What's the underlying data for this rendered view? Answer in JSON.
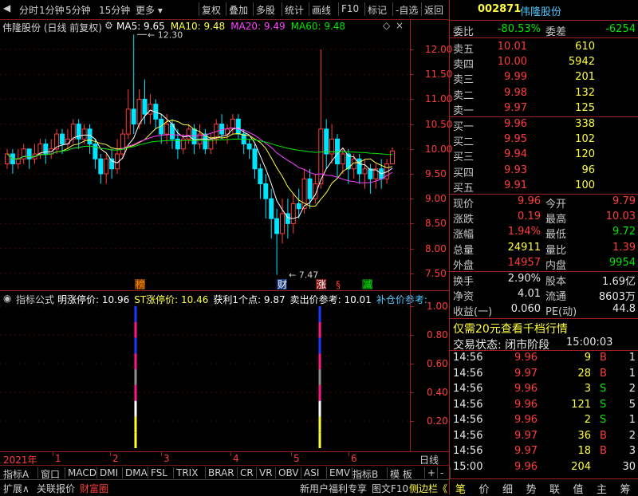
{
  "toolbar": {
    "left_items": [
      "分时",
      "1分钟",
      "5分钟",
      "15分钟",
      "更多"
    ],
    "right_items": [
      "复权",
      "叠加",
      "多股",
      "统计",
      "画线",
      "F10",
      "标记",
      "-自选",
      "返回"
    ]
  },
  "kline": {
    "title": "伟隆股份 (日线 前复权)",
    "ma": [
      {
        "label": "MA5: 9.65",
        "color": "#ffffff"
      },
      {
        "label": "MA10: 9.48",
        "color": "#ffff40"
      },
      {
        "label": "MA20: 9.49",
        "color": "#ff40ff"
      },
      {
        "label": "MA60: 9.48",
        "color": "#00e600"
      }
    ],
    "yticks": [
      "12.00",
      "11.50",
      "11.00",
      "10.50",
      "10.00",
      "9.50",
      "9.00",
      "8.50",
      "8.00",
      "7.50"
    ],
    "high_label": "12.30",
    "low_label": "7.47",
    "markers": [
      {
        "text": "榜",
        "color": "#ff8c00"
      },
      {
        "text": "财",
        "color": "#ffffff"
      },
      {
        "text": "涨",
        "color": "#ffffff"
      },
      {
        "text": "§",
        "color": "#ff3c3c"
      },
      {
        "text": "减",
        "color": "#00e600"
      }
    ]
  },
  "indicator": {
    "name": "指标公式",
    "items": [
      {
        "label": "明涨停价: 10.96",
        "color": "#ffffff"
      },
      {
        "label": "ST涨停价: 10.46",
        "color": "#ffff40"
      },
      {
        "label": "获利1个点: 9.87",
        "color": "#ffffff"
      },
      {
        "label": "卖出价参考: 10.01",
        "color": "#ffffff"
      },
      {
        "label": "补仓价参考:",
        "color": "#4fc8ff"
      }
    ],
    "yticks": [
      "1.00",
      "0.80",
      "0.60",
      "0.40",
      "0.20"
    ]
  },
  "xaxis": {
    "labels": [
      "2021年",
      "1",
      "2",
      "3",
      "4",
      "5",
      "6"
    ],
    "period": "日线"
  },
  "indicator_tabs": [
    "指标A",
    "窗口",
    "MACD",
    "DMI",
    "DMA",
    "FSL",
    "TRIX",
    "BRAR",
    "CR",
    "VR",
    "OBV",
    "ASI",
    "EMV",
    "指标B",
    "模 板",
    "+",
    "-"
  ],
  "statusbar": {
    "items": [
      "扩展∧",
      "关联报价",
      "财富圈"
    ],
    "right_items": [
      "新用户福利专享",
      "图文F10",
      "侧边栏《"
    ]
  },
  "quote": {
    "code": "002871",
    "name": "伟隆股份",
    "weibi_label": "委比",
    "weibi": "-80.53%",
    "weicha_label": "委差",
    "weicha": "-6254",
    "asks": [
      {
        "label": "卖五",
        "price": "10.01",
        "vol": "610"
      },
      {
        "label": "卖四",
        "price": "10.00",
        "vol": "5942"
      },
      {
        "label": "卖三",
        "price": "9.99",
        "vol": "201"
      },
      {
        "label": "卖二",
        "price": "9.98",
        "vol": "132"
      },
      {
        "label": "卖一",
        "price": "9.97",
        "vol": "125"
      }
    ],
    "bids": [
      {
        "label": "买一",
        "price": "9.96",
        "vol": "338"
      },
      {
        "label": "买二",
        "price": "9.95",
        "vol": "102"
      },
      {
        "label": "买三",
        "price": "9.94",
        "vol": "120"
      },
      {
        "label": "买四",
        "price": "9.93",
        "vol": "96"
      },
      {
        "label": "买五",
        "price": "9.91",
        "vol": "100"
      }
    ],
    "stats": [
      {
        "l1": "现价",
        "v1": "9.96",
        "c1": "red",
        "l2": "今开",
        "v2": "9.79",
        "c2": "red"
      },
      {
        "l1": "涨跌",
        "v1": "0.19",
        "c1": "red",
        "l2": "最高",
        "v2": "10.03",
        "c2": "red"
      },
      {
        "l1": "涨幅",
        "v1": "1.94%",
        "c1": "red",
        "l2": "最低",
        "v2": "9.72",
        "c2": "green"
      },
      {
        "l1": "总量",
        "v1": "24911",
        "c1": "yellow",
        "l2": "量比",
        "v2": "1.39",
        "c2": "red"
      },
      {
        "l1": "外盘",
        "v1": "14957",
        "c1": "red",
        "l2": "内盘",
        "v2": "9954",
        "c2": "green"
      }
    ],
    "stats2": [
      {
        "l1": "换手",
        "v1": "2.90%",
        "l2": "股本",
        "v2": "1.69亿"
      },
      {
        "l1": "净资",
        "v1": "4.01",
        "l2": "流通",
        "v2": "8603万"
      },
      {
        "l1": "收益(一)",
        "v1": "0.060",
        "l2": "PE(动)",
        "v2": "44.8"
      }
    ],
    "promo": "仅需20元查看千档行情",
    "trade_status_label": "交易状态: 闭市阶段",
    "trade_status_time": "15:00:03",
    "ticks": [
      {
        "time": "14:56",
        "price": "9.96",
        "vol": "9",
        "side": "B",
        "n": "1"
      },
      {
        "time": "14:56",
        "price": "9.97",
        "vol": "28",
        "side": "B",
        "n": "1"
      },
      {
        "time": "14:56",
        "price": "9.96",
        "vol": "3",
        "side": "S",
        "n": "2"
      },
      {
        "time": "14:56",
        "price": "9.96",
        "vol": "121",
        "side": "S",
        "n": "5"
      },
      {
        "time": "14:56",
        "price": "9.96",
        "vol": "2",
        "side": "S",
        "n": "1"
      },
      {
        "time": "14:56",
        "price": "9.97",
        "vol": "36",
        "side": "B",
        "n": "2"
      },
      {
        "time": "14:56",
        "price": "9.97",
        "vol": "18",
        "side": "B",
        "n": "3"
      },
      {
        "time": "15:00",
        "price": "9.96",
        "vol": "204",
        "side": "",
        "n": "30"
      }
    ],
    "bottom_tabs": [
      "笔",
      "价",
      "细",
      "势",
      "联",
      "值",
      "主",
      "筹"
    ]
  },
  "colors": {
    "up": "#ff3c3c",
    "down": "#00e5ff",
    "border": "#a02020",
    "ma5": "#ffffff",
    "ma10": "#ffff40",
    "ma20": "#ff40ff",
    "ma60": "#00e600"
  }
}
